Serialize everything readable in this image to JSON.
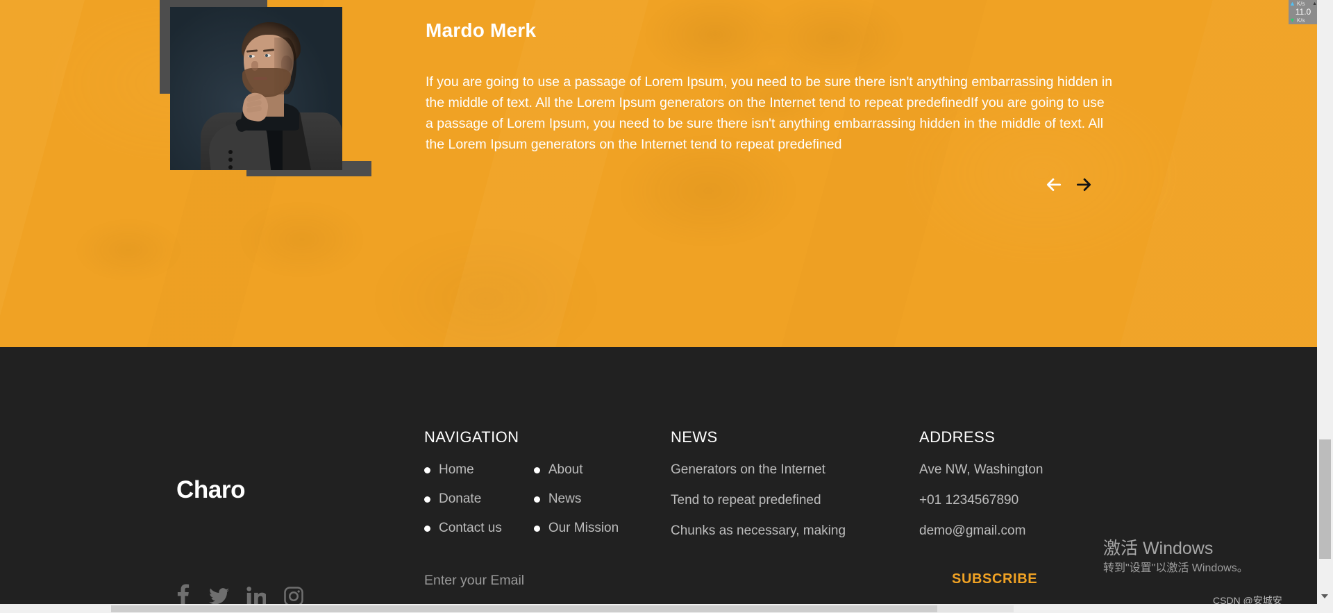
{
  "hero": {
    "name": "Mardo Merk",
    "paragraph": "If you are going to use a passage of Lorem Ipsum, you need to be sure there isn't anything embarrassing hidden in the middle of text. All the Lorem Ipsum generators on the Internet tend to repeat predefinedIf you are going to use a passage of Lorem Ipsum, you need to be sure there isn't anything embarrassing hidden in the middle of text. All the Lorem Ipsum generators on the Internet tend to repeat predefined",
    "prev_icon": "arrow-left-icon",
    "next_icon": "arrow-right-icon",
    "background_color": "#f0a224",
    "portrait_alt": "portrait-photo"
  },
  "footer": {
    "background_color": "#212121",
    "brand": "Charo",
    "socials": [
      {
        "name": "facebook-icon",
        "label": "Facebook"
      },
      {
        "name": "twitter-icon",
        "label": "Twitter"
      },
      {
        "name": "linkedin-icon",
        "label": "LinkedIn"
      },
      {
        "name": "instagram-icon",
        "label": "Instagram"
      }
    ],
    "navigation": {
      "title": "NAVIGATION",
      "column_one": [
        "Home",
        "Donate",
        "Contact us"
      ],
      "column_two": [
        "About",
        "News",
        "Our Mission"
      ]
    },
    "news": {
      "title": "NEWS",
      "items": [
        "Generators on the Internet",
        "Tend to repeat predefined",
        "Chunks as necessary, making"
      ]
    },
    "address": {
      "title": "ADDRESS",
      "items": [
        "Ave NW, Washington",
        "+01 1234567890",
        "demo@gmail.com"
      ]
    },
    "subscribe": {
      "placeholder": "Enter your Email",
      "value": "",
      "button_label": "SUBSCRIBE",
      "button_color": "#f0a224"
    }
  },
  "overlay": {
    "windows_activation_title": "激活 Windows",
    "windows_activation_subtitle": "转到\"设置\"以激活 Windows。",
    "watermark": "CSDN @安城安"
  },
  "netspeed": {
    "value": "11.0",
    "up_unit": "K/s",
    "down_unit": "K/s",
    "up_icon": "arrow-up-icon",
    "down_icon": "arrow-down-icon"
  }
}
